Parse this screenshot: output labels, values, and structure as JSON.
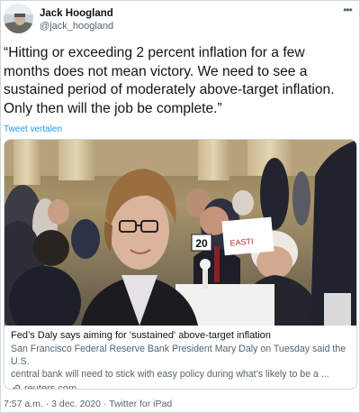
{
  "author": {
    "display_name": "Jack Hoogland",
    "handle": "@jack_hoogland"
  },
  "tweet": {
    "text_lines": [
      "“Hitting or exceeding 2 percent inflation for a few",
      "months does not mean victory. We need to see a",
      "sustained period of moderately above-target inflation.",
      "Only then will the job be complete.”"
    ],
    "translate_label": "Tweet vertalen"
  },
  "card": {
    "title": "Fed’s Daly says aiming for 'sustained' above-target inflation",
    "description_lines": [
      "San Francisco Federal Reserve Bank President Mary Daly on Tuesday said the U.S.",
      "central bank will need to stick with easy policy during what’s likely to be a ..."
    ],
    "domain": "reuters.com",
    "photo_table_number": "20",
    "photo_sign_text": "EASTI"
  },
  "footer": {
    "time": "7:57 a.m.",
    "separator": "·",
    "date": "3 dec. 2020",
    "source": "Twitter for iPad"
  },
  "colors": {
    "text": "#0f1419",
    "secondary": "#536471",
    "link": "#1d9bf0",
    "border": "#cfd9de"
  },
  "icons": {
    "more": "more-options-icon",
    "link": "link-icon"
  }
}
